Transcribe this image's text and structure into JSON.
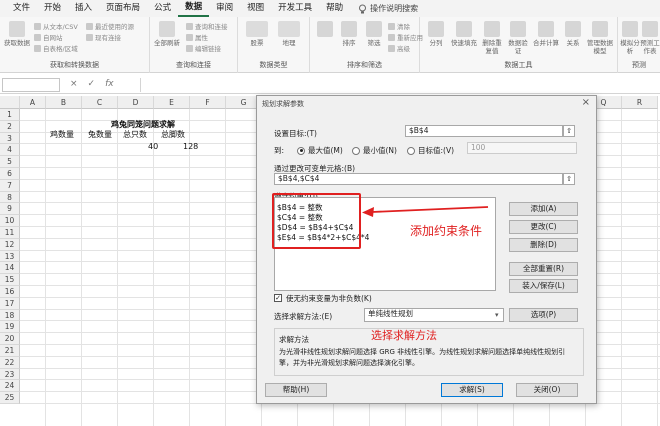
{
  "menu": {
    "items": [
      "文件",
      "开始",
      "插入",
      "页面布局",
      "公式",
      "数据",
      "审阅",
      "视图",
      "开发工具",
      "帮助"
    ],
    "active_index": 5,
    "search_label": "操作说明搜索"
  },
  "ribbon": {
    "group_labels": {
      "get_transform": "获取和转换数据",
      "queries": "查询和连接",
      "data_types": "数据类型",
      "sort_filter": "排序和筛选",
      "data_tools": "数据工具",
      "forecast": "预测"
    },
    "get_data_label": "获取数据",
    "from_text_csv": "从文本/CSV",
    "from_web": "自网站",
    "from_table": "自表格/区域",
    "recent_sources": "最近使用的源",
    "existing_connections": "现有连接",
    "refresh_all": "全部刷新",
    "queries_connections": "查询和连接",
    "properties": "属性",
    "edit_links": "编辑链接",
    "data_type_stock": "股票",
    "data_type_geo": "地理",
    "sort": "排序",
    "filter": "筛选",
    "clear": "清除",
    "reapply": "重新应用",
    "advanced": "高级",
    "text_to_columns": "分列",
    "flash_fill": "快速填充",
    "remove_duplicates": "删除重复值",
    "data_validation": "数据验证",
    "consolidate": "合并计算",
    "relationships": "关系",
    "manage_model": "管理数据模型",
    "what_if": "模拟分析",
    "forecast_sheet": "预测工作表"
  },
  "formula_bar": {
    "fx": "fx",
    "cancel": "×",
    "enter": "✓"
  },
  "grid": {
    "columns": [
      "A",
      "B",
      "C",
      "D",
      "E",
      "F",
      "G",
      "H",
      "I",
      "J",
      "K",
      "L",
      "M",
      "N",
      "O",
      "P",
      "Q",
      "R"
    ],
    "rows": [
      "1",
      "2",
      "3",
      "4",
      "5",
      "6",
      "7",
      "8",
      "9",
      "10",
      "11",
      "12",
      "13",
      "14",
      "15",
      "16",
      "17",
      "18",
      "19",
      "20",
      "21",
      "22",
      "23",
      "24",
      "25"
    ],
    "title": "鸡兔同笼问题求解",
    "headers": [
      "鸡数量",
      "兔数量",
      "总只数",
      "总脚数"
    ],
    "values": {
      "D4": "40",
      "E4": "128"
    }
  },
  "dialog": {
    "title": "规划求解参数",
    "close": "×",
    "set_objective_label": "设置目标:(T)",
    "set_objective_value": "$B$4",
    "to_label": "到:",
    "max_label": "最大值(M)",
    "min_label": "最小值(N)",
    "value_of_label": "目标值:(V)",
    "value_of_value": "100",
    "changing_cells_label": "通过更改可变单元格:(B)",
    "changing_cells_value": "$B$4,$C$4",
    "constraints_label": "遵守约束:(U)",
    "constraints": [
      "$B$4 = 整数",
      "$C$4 = 整数",
      "$D$4 = $B$4+$C$4",
      "$E$4 = $B$4*2+$C$4*4"
    ],
    "add": "添加(A)",
    "change": "更改(C)",
    "delete": "删除(D)",
    "reset_all": "全部重置(R)",
    "load_save": "装入/保存(L)",
    "nonneg_label": "使无约束变量为非负数(K)",
    "method_label": "选择求解方法:(E)",
    "method_value": "单纯线性规划",
    "options": "选项(P)",
    "method_group_label": "求解方法",
    "method_desc_1": "为光滑非线性规划求解问题选择 GRG 非线性引擎。为线性规划求解问题选择单纯线性规划引",
    "method_desc_2": "擎，并为非光滑规划求解问题选择演化引擎。",
    "help": "帮助(H)",
    "solve": "求解(S)",
    "close_btn": "关闭(O)"
  },
  "annotations": {
    "add_constraint": "添加约束条件",
    "choose_method": "选择求解方法"
  },
  "colors": {
    "accent_green": "#217346",
    "annotation_red": "#e02020"
  }
}
